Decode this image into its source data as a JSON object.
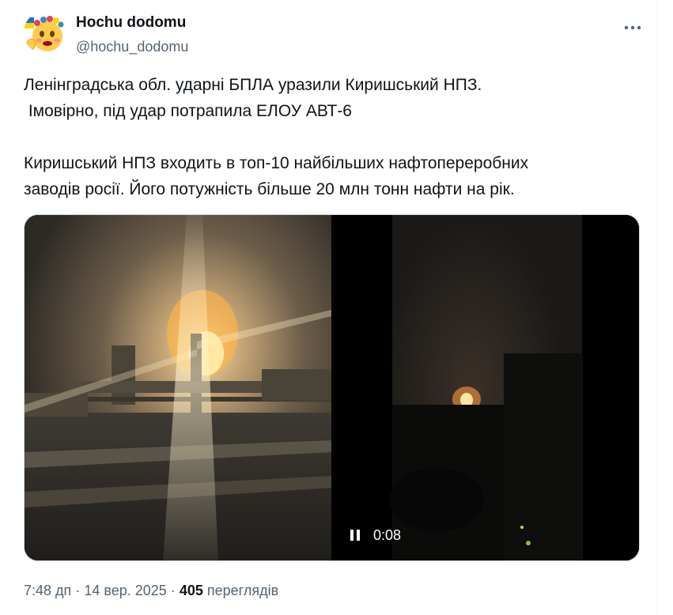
{
  "author": {
    "display_name": "Hochu dodomu",
    "handle": "@hochu_dodomu",
    "avatar_icon": "emoji-face-with-flower-crown-icon"
  },
  "tweet": {
    "lines": [
      "Ленінградська обл. ударні БПЛА уразили Киришський НПЗ.",
      " Імовірно, під удар потрапила ЕЛОУ АВТ-6",
      "",
      "Киришський НПЗ входить в топ-10 найбільших нафтопереробних",
      "заводів росії. Його потужність більше 20 млн тонн нафти на рік."
    ]
  },
  "media": {
    "video_time": "0:08",
    "pause_icon": "pause-icon"
  },
  "meta": {
    "time": "7:48 дп",
    "separator": "·",
    "date": "14 вер. 2025",
    "views_count": "405",
    "views_label": "переглядів"
  },
  "colors": {
    "text_primary": "#0f1419",
    "text_secondary": "#536471",
    "border": "#cfd9de"
  }
}
